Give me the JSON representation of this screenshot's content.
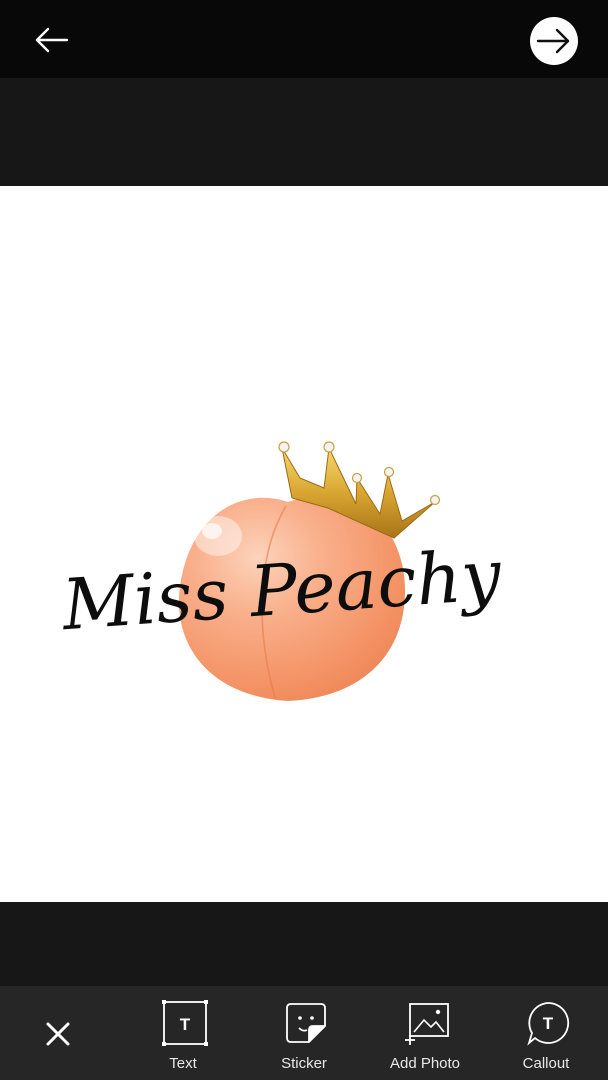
{
  "toolbar": {
    "items": [
      {
        "label": "Text",
        "icon": "text-icon"
      },
      {
        "label": "Sticker",
        "icon": "sticker-icon"
      },
      {
        "label": "Add Photo",
        "icon": "add-photo-icon"
      },
      {
        "label": "Callout",
        "icon": "callout-icon"
      }
    ]
  },
  "canvas": {
    "logo_text": "Miss Peachy",
    "peach_color": "#F8A07A",
    "crown_color": "#D9A531"
  },
  "colors": {
    "topbar": "#080808",
    "background": "#171717",
    "toolbar": "#262626",
    "canvas": "#FFFFFF"
  }
}
